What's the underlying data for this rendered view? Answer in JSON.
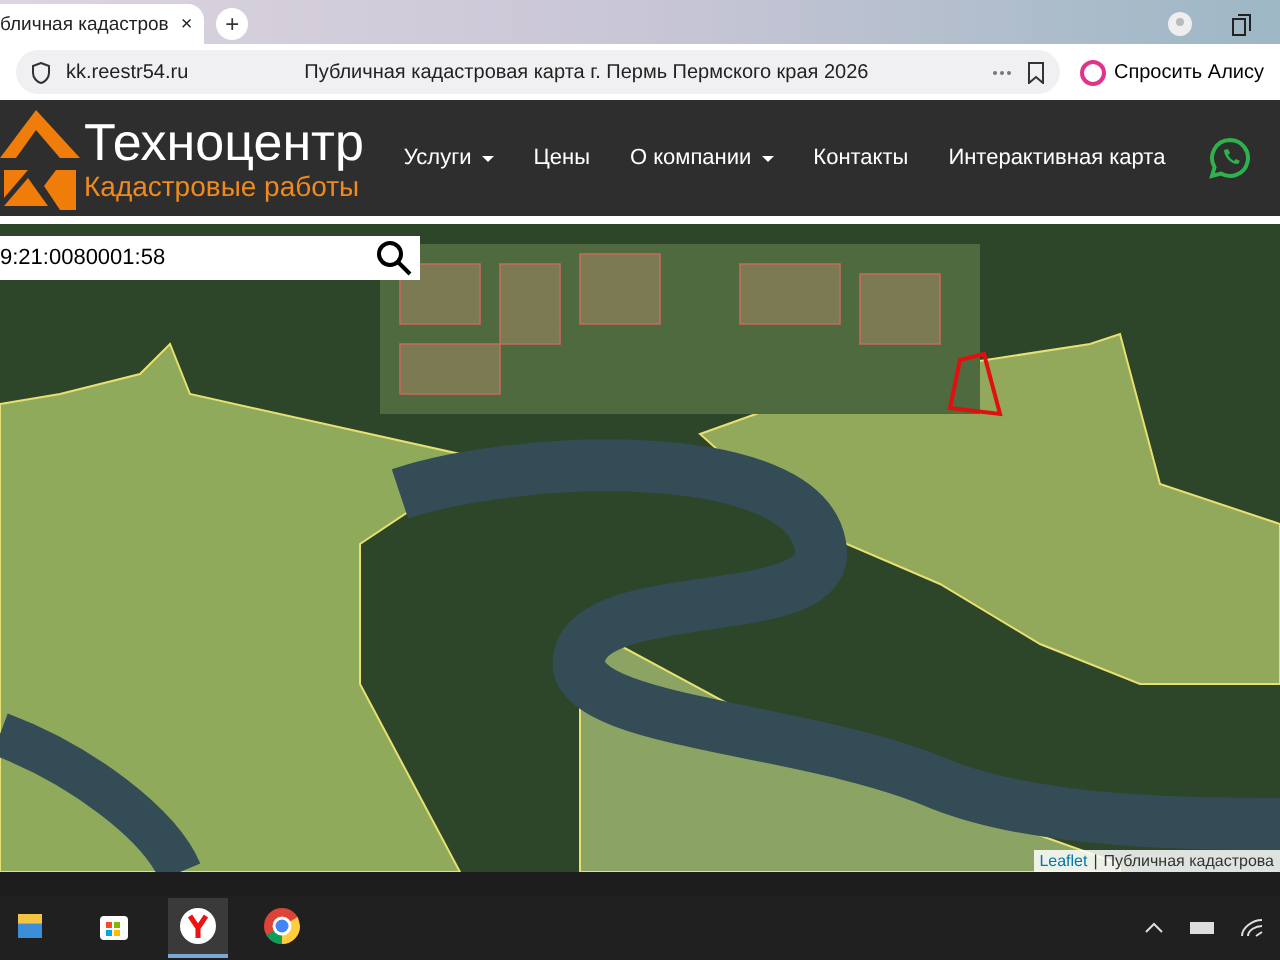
{
  "browser": {
    "tab": {
      "title": "бличная кадастров",
      "close": "×",
      "selected": true
    },
    "new_tab": "+",
    "address": "kk.reestr54.ru",
    "page_title": "Публичная кадастровая карта г. Пермь Пермского края 2026",
    "assistant_button": "Спросить Алису"
  },
  "site": {
    "logo_title": "Техноцентр",
    "logo_subtitle": "Кадастровые работы",
    "nav": [
      {
        "label": "Услуги",
        "dropdown": true
      },
      {
        "label": "Цены",
        "dropdown": false
      },
      {
        "label": "О компании",
        "dropdown": true
      },
      {
        "label": "Контакты",
        "dropdown": false
      },
      {
        "label": "Интерактивная карта",
        "dropdown": false
      }
    ]
  },
  "map": {
    "search": {
      "value": "9:21:0080001:58"
    },
    "attribution": {
      "link": "Leaflet",
      "separator": "|",
      "text": "Публичная кадастрова"
    }
  },
  "taskbar": {
    "apps": [
      {
        "kind": "explorer",
        "active": false
      },
      {
        "kind": "store",
        "active": false
      },
      {
        "kind": "yandex",
        "active": true
      },
      {
        "kind": "chrome",
        "active": false
      }
    ]
  }
}
